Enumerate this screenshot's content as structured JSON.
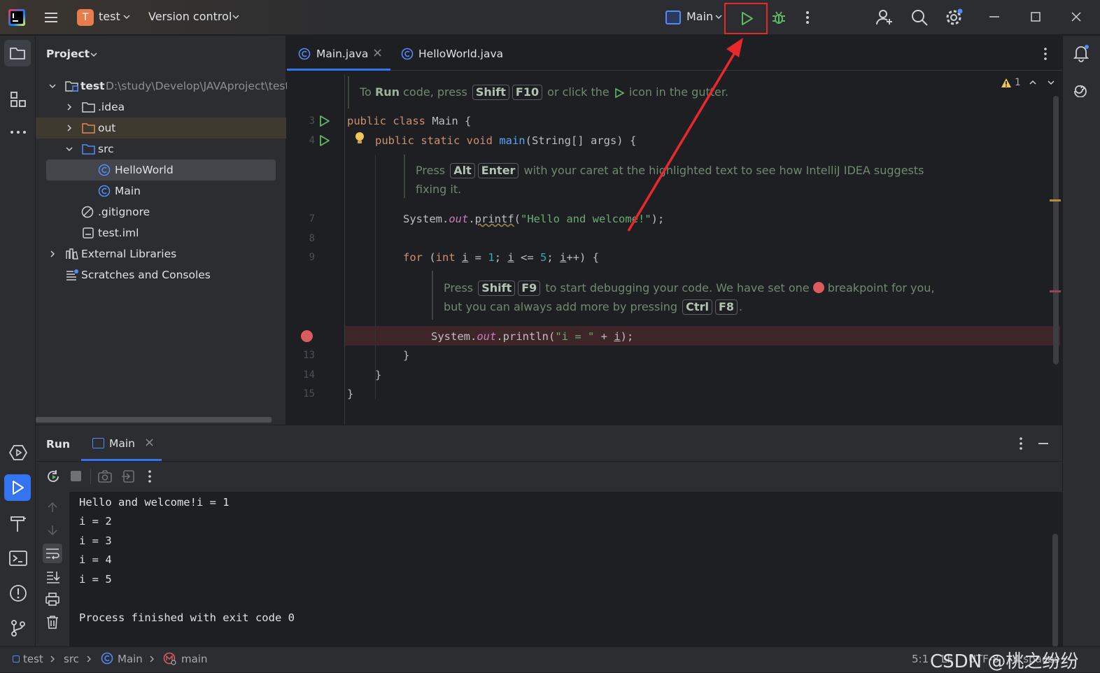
{
  "titlebar": {
    "project_initial": "T",
    "project_name": "test",
    "vcs_label": "Version control",
    "run_config": "Main"
  },
  "project_panel": {
    "title": "Project",
    "root_name": "test",
    "root_path": "D:\\study\\Develop\\JAVAproject\\test",
    "items": [
      {
        "label": "test"
      },
      {
        "label": ".idea"
      },
      {
        "label": "out"
      },
      {
        "label": "src"
      },
      {
        "label": "HelloWorld"
      },
      {
        "label": "Main"
      },
      {
        "label": ".gitignore"
      },
      {
        "label": "test.iml"
      },
      {
        "label": "External Libraries"
      },
      {
        "label": "Scratches and Consoles"
      }
    ]
  },
  "editor": {
    "tabs": [
      {
        "label": "Main.java",
        "close": "×"
      },
      {
        "label": "HelloWorld.java"
      }
    ],
    "warning_count": "1",
    "hint1": {
      "pre": "To ",
      "bold": "Run",
      "mid": " code, press ",
      "k1": "Shift",
      "k2": "F10",
      "post1": " or click the ",
      "post2": " icon in the gutter."
    },
    "hint2": {
      "pre": "Press ",
      "k1": "Alt",
      "k2": "Enter",
      "post": " with your caret at the highlighted text to see how IntelliJ IDEA suggests",
      "line2": "fixing it."
    },
    "hint3": {
      "pre": "Press ",
      "k1": "Shift",
      "k2": "F9",
      "post": " to start debugging your code. We have set one ",
      "post2": " breakpoint for you,",
      "line2pre": "but you can always add more by pressing ",
      "k3": "Ctrl",
      "k4": "F8",
      "line2post": "."
    },
    "line_numbers": {
      "l3": "3",
      "l4": "4",
      "l7": "7",
      "l8": "8",
      "l9": "9",
      "l13": "13",
      "l14": "14",
      "l15": "15"
    },
    "code": {
      "l3_kw": "public class ",
      "l3_rest": "Main {",
      "l4_kw": "public static void ",
      "l4_fn": "main",
      "l4_rest": "(String[] args) {",
      "l7_a": "System.",
      "l7_fld": "out",
      "l7_b": ".",
      "l7_fn": "printf",
      "l7_c": "(",
      "l7_str": "\"Hello and welcome!\"",
      "l7_d": ");",
      "l9_kw": "for ",
      "l9_a": "(",
      "l9_kw2": "int ",
      "l9_b": "i",
      "l9_c": " = ",
      "l9_n1": "1",
      "l9_d": "; ",
      "l9_e": "i",
      "l9_f": " <= ",
      "l9_n2": "5",
      "l9_g": "; ",
      "l9_h": "i",
      "l9_i": "++) {",
      "l12_a": "System.",
      "l12_fld": "out",
      "l12_b": ".println(",
      "l12_str": "\"i = \"",
      "l12_c": " + ",
      "l12_d": "i",
      "l12_e": ");",
      "l13": "}",
      "l14": "}",
      "l15": "}"
    }
  },
  "run_panel": {
    "title": "Run",
    "tab_label": "Main",
    "tab_close": "×",
    "output": [
      "Hello and welcome!i = 1",
      "i = 2",
      "i = 3",
      "i = 4",
      "i = 5",
      "",
      "Process finished with exit code 0"
    ]
  },
  "statusbar": {
    "crumbs": [
      "test",
      "src",
      "Main",
      "main"
    ],
    "position": "5:1",
    "line_sep": "LF",
    "encoding": "UTF-8",
    "indent": "4 spaces",
    "watermark": "CSDN @桃之纷纷"
  },
  "colors": {
    "accent": "#3574f0",
    "run_green": "#5fb865",
    "annotation_red": "#e8282b",
    "breakpoint": "#db5c5c"
  }
}
